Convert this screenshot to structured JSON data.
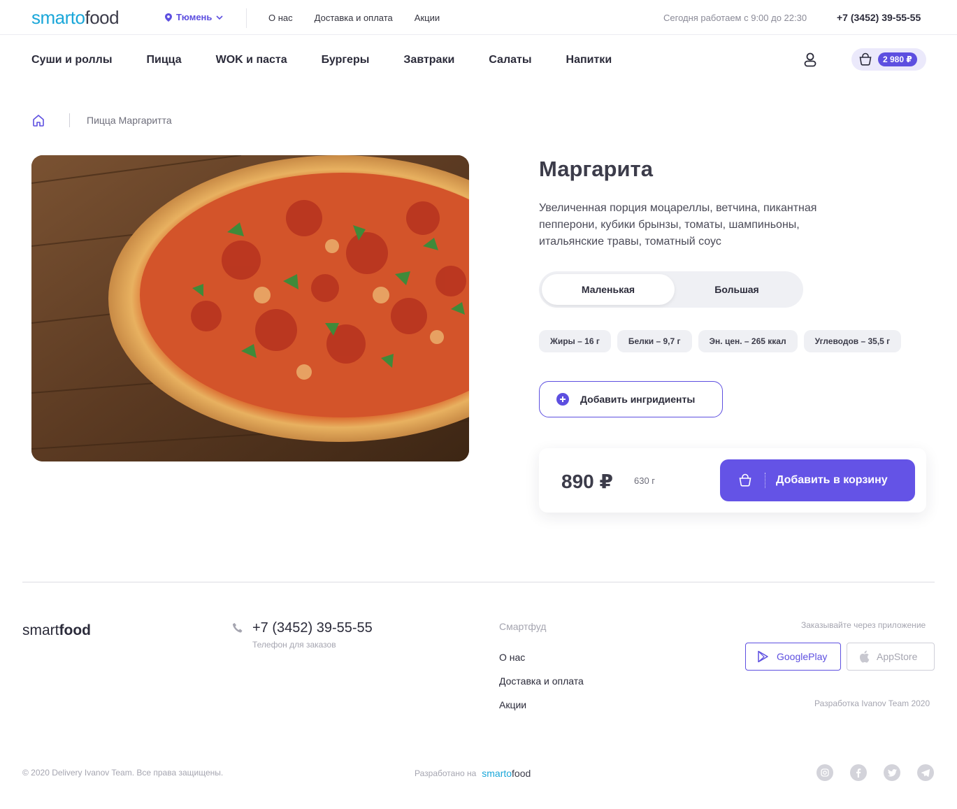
{
  "header": {
    "logo_part1": "smarto",
    "logo_part2": "food",
    "city": "Тюмень",
    "nav": [
      "О нас",
      "Доставка и оплата",
      "Акции"
    ],
    "hours": "Сегодня работаем с 9:00 до 22:30",
    "phone": "+7 (3452) 39-55-55"
  },
  "menu": {
    "categories": [
      "Суши и роллы",
      "Пицца",
      "WOK и паста",
      "Бургеры",
      "Завтраки",
      "Салаты",
      "Напитки"
    ],
    "cart_total": "2 980 ₽"
  },
  "breadcrumb": {
    "current": "Пицца Маргаритта"
  },
  "product": {
    "title": "Маргарита",
    "description": "Увеличенная порция моцареллы, ветчина, пикантная пепперони, кубики брынзы, томаты, шампиньоны, итальянские травы, томатный соус",
    "sizes": [
      "Маленькая",
      "Большая"
    ],
    "selected_size": "Маленькая",
    "nutrition": [
      "Жиры – 16 г",
      "Белки – 9,7 г",
      "Эн. цен. – 265 ккал",
      "Углеводов – 35,5 г"
    ],
    "add_ingredients_label": "Добавить ингридиенты",
    "price": "890 ₽",
    "weight": "630 г",
    "add_to_cart_label": "Добавить в корзину"
  },
  "footer": {
    "logo_light": "smart",
    "logo_bold": "food",
    "phone": "+7 (3452) 39-55-55",
    "phone_caption": "Телефон для заказов",
    "column_title": "Смартфуд",
    "links": [
      "О нас",
      "Доставка и оплата",
      "Акции"
    ],
    "app_caption": "Заказывайте через приложение",
    "google_play": "GooglePlay",
    "app_store": "AppStore",
    "dev_credit": "Разработка Ivanov Team 2020",
    "copyright": "© 2020 Delivery Ivanov Team. Все права защищены.",
    "made_on": "Разработано на",
    "made_on_logo_part1": "smarto",
    "made_on_logo_part2": "food"
  },
  "colors": {
    "accent": "#5d4fe0",
    "logo_blue": "#1aa7d9",
    "text_dark": "#2b2b3a",
    "muted": "#a5a5b0"
  }
}
